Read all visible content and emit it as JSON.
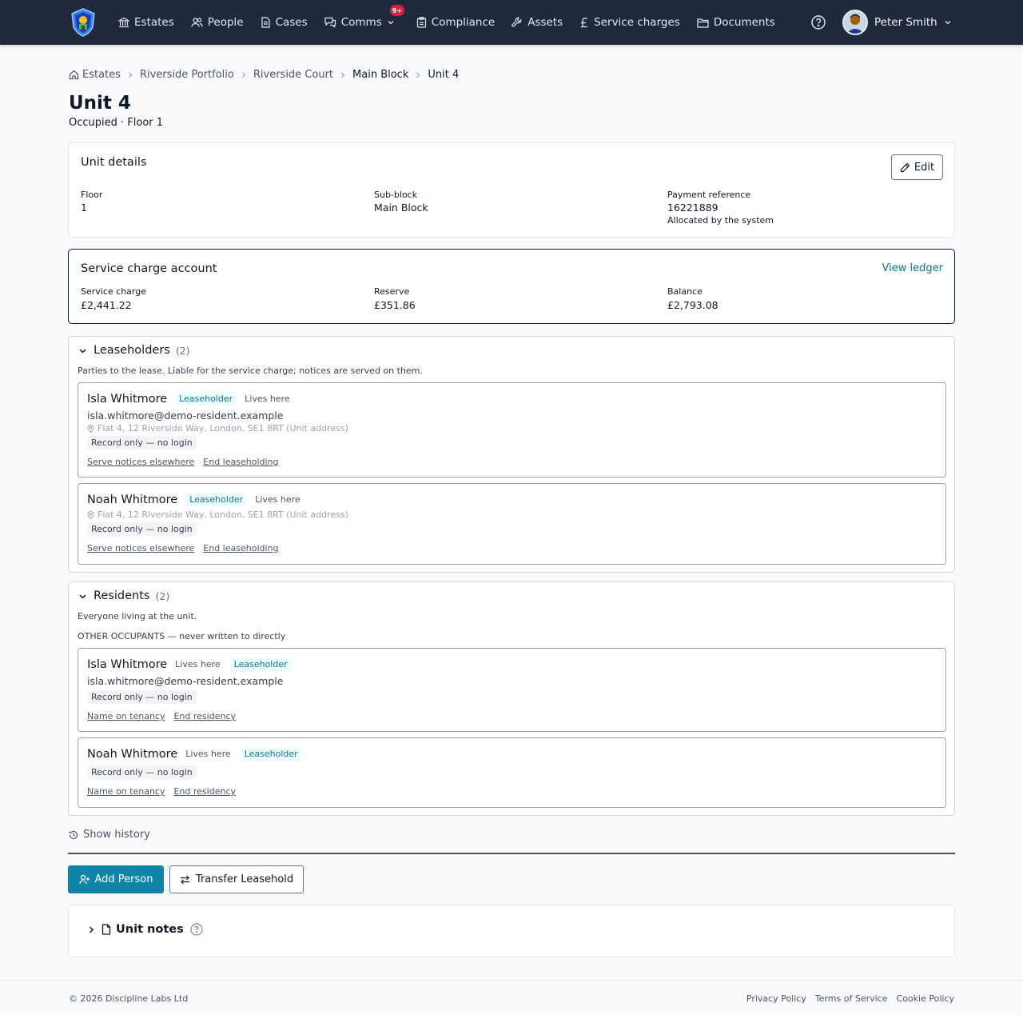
{
  "nav": {
    "items": [
      {
        "label": "Estates",
        "icon": "bank-icon"
      },
      {
        "label": "People",
        "icon": "people-icon"
      },
      {
        "label": "Cases",
        "icon": "document-icon"
      },
      {
        "label": "Comms",
        "icon": "chat-icon",
        "badge": "9+"
      },
      {
        "label": "Compliance",
        "icon": "clipboard-icon"
      },
      {
        "label": "Assets",
        "icon": "wrench-icon"
      },
      {
        "label": "Service charges",
        "icon": "pound-icon"
      },
      {
        "label": "Documents",
        "icon": "folder-icon"
      }
    ],
    "user_name": "Peter Smith"
  },
  "breadcrumb": [
    "Estates",
    "Riverside Portfolio",
    "Riverside Court",
    "Main Block",
    "Unit 4"
  ],
  "page": {
    "title": "Unit 4",
    "subtitle": "Occupied · Floor 1"
  },
  "unit_details": {
    "title": "Unit details",
    "edit_label": "Edit",
    "floor_label": "Floor",
    "floor_value": "1",
    "subblock_label": "Sub-block",
    "subblock_value": "Main Block",
    "payref_label": "Payment reference",
    "payref_value": "16221889",
    "payref_note": "Allocated by the system"
  },
  "service_account": {
    "title": "Service charge account",
    "view_ledger": "View ledger",
    "charge_label": "Service charge",
    "charge_value": "£2,441.22",
    "reserve_label": "Reserve",
    "reserve_value": "£351.86",
    "balance_label": "Balance",
    "balance_value": "£2,793.08"
  },
  "leaseholders": {
    "title": "Leaseholders",
    "count": "(2)",
    "description": "Parties to the lease. Liable for the service charge; notices are served on them.",
    "people": [
      {
        "name": "Isla Whitmore",
        "role": "Leaseholder",
        "lives": "Lives here",
        "email": "isla.whitmore@demo-resident.example",
        "address": "Flat 4, 12 Riverside Way, London, SE1 8RT (Unit address)",
        "record": "Record only — no login",
        "link1": "Serve notices elsewhere",
        "link2": "End leaseholding"
      },
      {
        "name": "Noah Whitmore",
        "role": "Leaseholder",
        "lives": "Lives here",
        "address": "Flat 4, 12 Riverside Way, London, SE1 8RT (Unit address)",
        "record": "Record only — no login",
        "link1": "Serve notices elsewhere",
        "link2": "End leaseholding"
      }
    ]
  },
  "residents": {
    "title": "Residents",
    "count": "(2)",
    "description": "Everyone living at the unit.",
    "kicker": "OTHER OCCUPANTS  — never written to directly",
    "people": [
      {
        "name": "Isla Whitmore",
        "lives": "Lives here",
        "role": "Leaseholder",
        "email": "isla.whitmore@demo-resident.example",
        "record": "Record only — no login",
        "link1": "Name on tenancy",
        "link2": "End residency"
      },
      {
        "name": "Noah Whitmore",
        "lives": "Lives here",
        "role": "Leaseholder",
        "record": "Record only — no login",
        "link1": "Name on tenancy",
        "link2": "End residency"
      }
    ]
  },
  "actions": {
    "show_history": "Show history",
    "add_person": "Add Person",
    "transfer": "Transfer Leasehold"
  },
  "notes": {
    "title": "Unit notes"
  },
  "footer": {
    "copyright": "© 2026 Discipline Labs Ltd",
    "links": [
      "Privacy Policy",
      "Terms of Service",
      "Cookie Policy"
    ]
  },
  "colors": {
    "nav_bg": "#1e293b",
    "accent": "#0e84a8",
    "link": "#0e7490",
    "badge": "#e11d48"
  }
}
